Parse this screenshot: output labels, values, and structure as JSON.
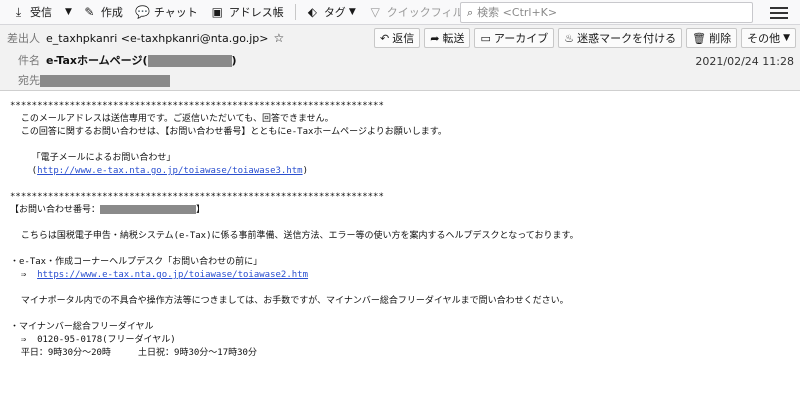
{
  "toolbar": {
    "receive": "受信",
    "compose": "作成",
    "chat": "チャット",
    "address_book": "アドレス帳",
    "tag": "タグ",
    "quick_filter": "クイックフィルター",
    "search_placeholder": "検索 <Ctrl+K>"
  },
  "header": {
    "from_label": "差出人",
    "from_value": "e_taxhpkanri <e-taxhpkanri@nta.go.jp>",
    "subject_label": "件名",
    "subject_prefix": "e-Taxホームページ(",
    "subject_suffix": ")",
    "to_label": "宛先",
    "date": "2021/02/24 11:28",
    "actions": {
      "reply": "返信",
      "forward": "転送",
      "archive": "アーカイブ",
      "junk": "迷惑マークを付ける",
      "delete": "削除",
      "other": "その他"
    }
  },
  "body": {
    "stars1": "*********************************************************************",
    "l1": "  このメールアドレスは送信専用です。ご返信いただいても、回答できません。",
    "l2": "  この回答に関するお問い合わせは、【お問い合わせ番号】とともにe-Taxホームページよりお願いします。",
    "l3": "    「電子メールによるお問い合わせ」",
    "l4_open": "    (",
    "link1": "http://www.e-tax.nta.go.jp/toiawase/toiawase3.htm",
    "l4_close": ")",
    "stars2": "*********************************************************************",
    "ref_label": "【お問い合わせ番号：",
    "ref_close": "】",
    "l5": "  こちらは国税電子申告・納税システム(e-Tax)に係る事前準備、送信方法、エラー等の使い方を案内するヘルプデスクとなっております。",
    "l6": "・e-Tax・作成コーナーヘルプデスク「お問い合わせの前に」",
    "l7_prefix": "  ⇒  ",
    "link2": "https://www.e-tax.nta.go.jp/toiawase/toiawase2.htm",
    "l8": "  マイナポータル内での不具合や操作方法等につきましては、お手数ですが、マイナンバー総合フリーダイヤルまで問い合わせください。",
    "l9": "・マイナンバー総合フリーダイヤル",
    "l10": "  ⇒  0120-95-0178(フリーダイヤル)",
    "l11": "  平日：9時30分～20時     土日祝：9時30分～17時30分"
  }
}
